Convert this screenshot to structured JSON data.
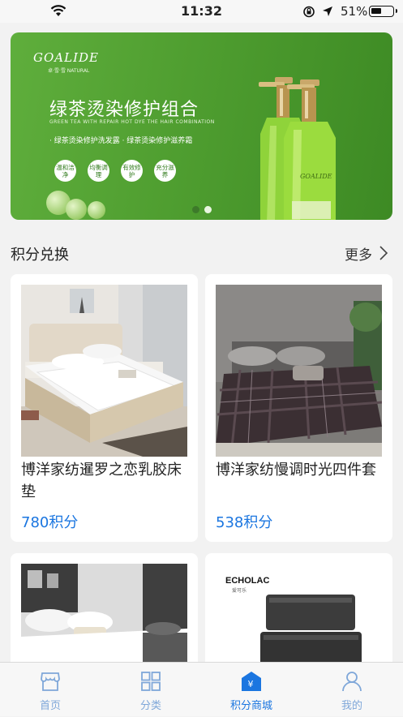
{
  "status_bar": {
    "time": "11:32",
    "battery": "51%",
    "battery_level": 0.51
  },
  "banner": {
    "brand": "GOALIDE",
    "brand_sub": "卓·雪·雪  NATURAL",
    "headline": "绿茶烫染修护组合",
    "tagline": "GREEN TEA WITH REPAIR HOT DYE THE HAIR COMBINATION",
    "products": "· 绿茶烫染修护洗发露   · 绿茶烫染修护滋养霜",
    "badges": [
      "温和洁净",
      "均衡调理",
      "有效修护",
      "充分滋养"
    ],
    "bottle_label": "GOALIDE",
    "page_count": 2,
    "active_page": 2,
    "colors": {
      "dot_inactive": "#3d7a2a",
      "dot_active": "#e8f5e0"
    }
  },
  "section": {
    "title": "积分兑换",
    "more_label": "更多"
  },
  "products": [
    {
      "name": "博洋家纺暹罗之恋乳胶床垫",
      "points": "780积分",
      "image": "white-mattress-bed-photo"
    },
    {
      "name": "博洋家纺慢调时光四件套",
      "points": "538积分",
      "image": "plaid-bedding-set-photo"
    },
    {
      "name": "",
      "points": "",
      "image": "white-bedding-room-photo"
    },
    {
      "name": "",
      "points": "",
      "image": "storage-bags-photo",
      "brand": "ECHOLAC",
      "brand_sub": "爱可乐"
    }
  ],
  "tabbar": {
    "items": [
      {
        "label": "首页",
        "icon": "store-icon",
        "active": false
      },
      {
        "label": "分类",
        "icon": "grid-icon",
        "active": false
      },
      {
        "label": "积分商城",
        "icon": "points-mall-icon",
        "active": true
      },
      {
        "label": "我的",
        "icon": "user-icon",
        "active": false
      }
    ]
  },
  "colors": {
    "accent": "#1b76e0",
    "tab_inactive": "#7fa7d9",
    "background": "#f2f2f2"
  }
}
